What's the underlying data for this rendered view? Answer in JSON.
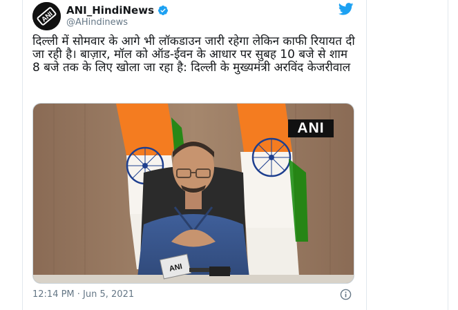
{
  "tweet": {
    "display_name": "ANI_HindiNews",
    "handle": "@AHindinews",
    "verified": true,
    "text": "दिल्ली में सोमवार के आगे भी लॉकडाउन जारी रहेगा लेकिन काफी रियायत दी जा रही है। बाज़ार, मॉल को ऑड-ईवन के आधार पर सुबह 10 बजे से शाम 8 बजे तक के लिए खोला जा रहा है: दिल्ली के मुख्यमंत्री अरविंद केजरीवाल",
    "timestamp": "12:14 PM · Jun 5, 2021"
  },
  "avatar": {
    "logo_text": "ANI"
  },
  "media": {
    "badge": "ANI",
    "mic_label": "ANI"
  },
  "icons": {
    "verified": "verified-badge-icon",
    "brand": "twitter-bird-icon",
    "info": "info-icon"
  },
  "colors": {
    "twitter_blue": "#1da1f2",
    "secondary_text": "#657786",
    "saffron": "#f47c20",
    "india_green": "#138808",
    "chakra": "#1e3f8f"
  }
}
